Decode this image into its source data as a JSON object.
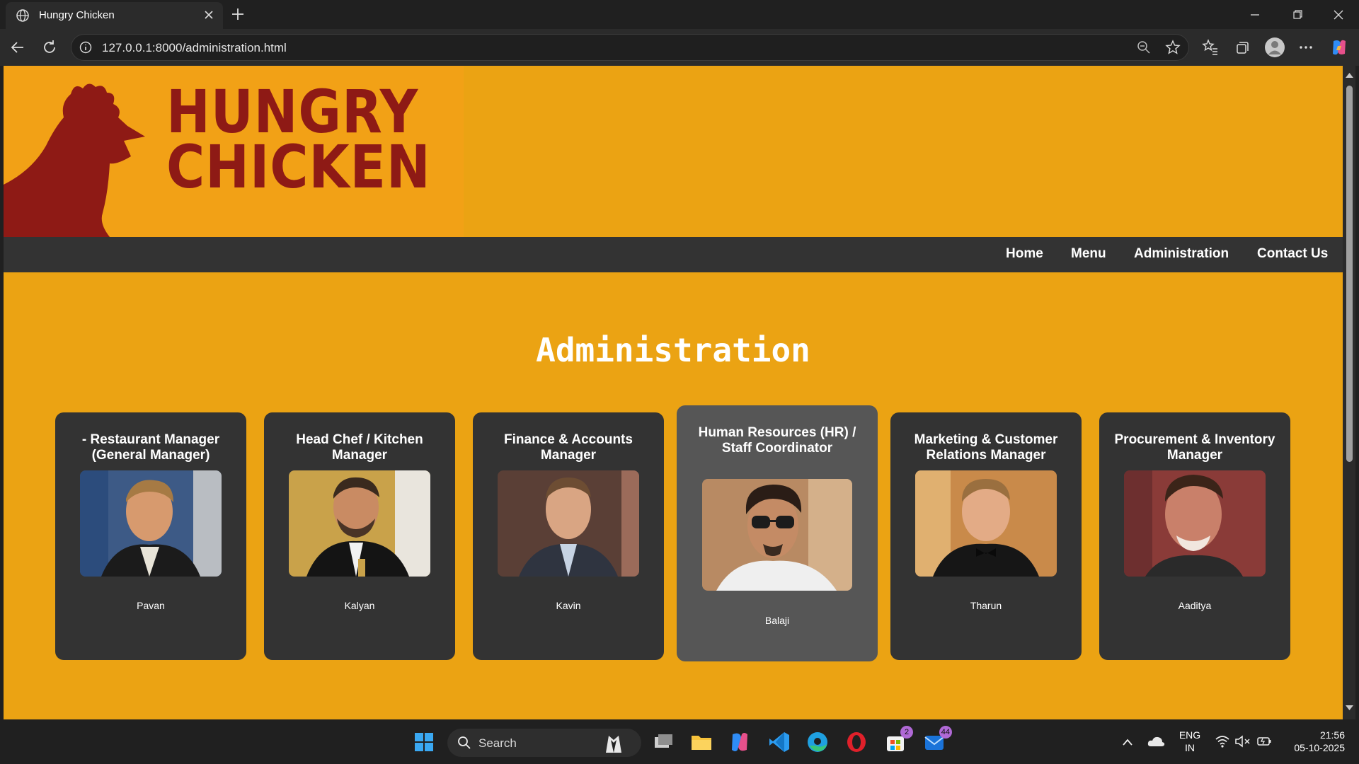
{
  "browser": {
    "tab_title": "Hungry Chicken",
    "url": "127.0.0.1:8000/administration.html"
  },
  "site": {
    "logo_line1": "HUNGRY",
    "logo_line2": "CHICKEN",
    "nav": [
      "Home",
      "Menu",
      "Administration",
      "Contact Us"
    ]
  },
  "page": {
    "heading": "Administration",
    "cards": [
      {
        "title": "- Restaurant Manager (General Manager)",
        "name": "Pavan"
      },
      {
        "title": "Head Chef / Kitchen Manager",
        "name": "Kalyan"
      },
      {
        "title": "Finance & Accounts Manager",
        "name": "Kavin"
      },
      {
        "title": "Human Resources (HR) / Staff Coordinator",
        "name": "Balaji"
      },
      {
        "title": "Marketing & Customer Relations Manager",
        "name": "Tharun"
      },
      {
        "title": "Procurement & Inventory Manager",
        "name": "Aaditya"
      }
    ]
  },
  "taskbar": {
    "search_label": "Search",
    "store_badge": "2",
    "mail_badge": "44",
    "lang_line1": "ENG",
    "lang_line2": "IN",
    "time": "21:56",
    "date": "05-10-2025"
  },
  "colors": {
    "page_background": "#eba313",
    "logo_red": "#8e1a15",
    "nav_background": "#333333",
    "card_background": "#333333",
    "card_highlight": "#565656"
  }
}
